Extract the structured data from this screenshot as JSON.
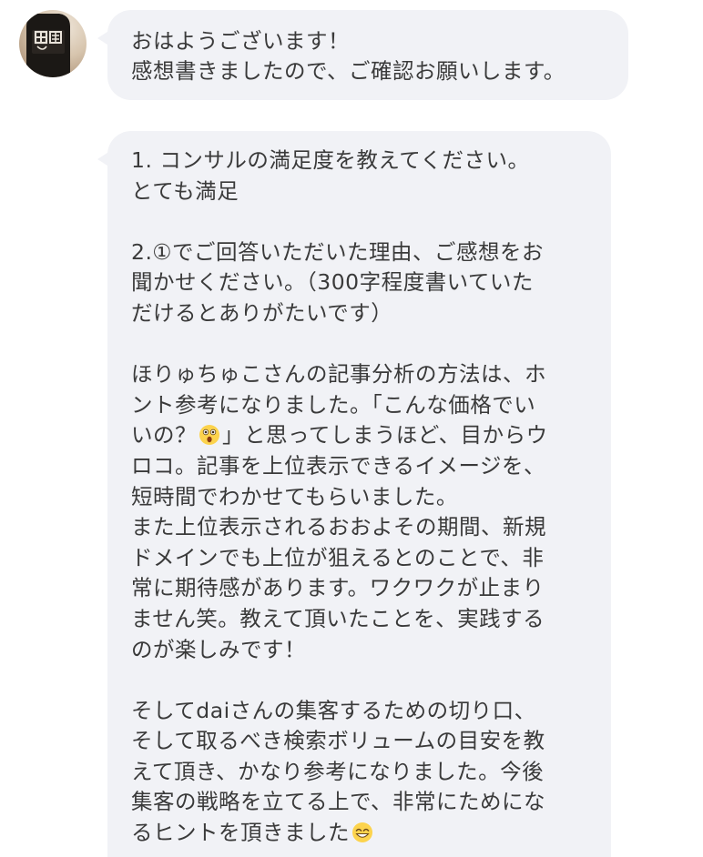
{
  "sender": {
    "avatar_icon": "sake-bottle-avatar-icon"
  },
  "messages": [
    {
      "lines": [
        "おはようございます！",
        "感想書きましたので、ご確認お願いします。"
      ]
    },
    {
      "q1": {
        "question": "1. コンサルの満足度を教えてください。",
        "answer": "とても満足"
      },
      "q2": {
        "question_lines": [
          "2.①でご回答いただいた理由、ご感想をお",
          "聞かせください。（300字程度書いていた",
          "だけるとありがたいです）"
        ]
      },
      "paragraph1": {
        "line1": "ほりゅちゅこさんの記事分析の方法は、ホ",
        "line2": "ント参考になりました。「こんな価格でい",
        "line3_before": "いの？",
        "line3_emoji": "astonished-face-emoji",
        "line3_after": "」と思ってしまうほど、目からウ",
        "line4": "ロコ。記事を上位表示できるイメージを、",
        "line5": "短時間でわかせてもらいました。",
        "line6": "また上位表示されるおおよその期間、新規",
        "line7": "ドメインでも上位が狙えるとのことで、非",
        "line8": "常に期待感があります。ワクワクが止まり",
        "line9": "ません笑。教えて頂いたことを、実践する",
        "line10": "のが楽しみです！"
      },
      "paragraph2": {
        "line1": "そしてdaiさんの集客するための切り口、",
        "line2": "そして取るべき検索ボリュームの目安を教",
        "line3": "えて頂き、かなり参考になりました。今後",
        "line4": "集客の戦略を立てる上で、非常にためにな",
        "line5_before": "るヒントを頂きました",
        "line5_emoji": "grinning-smiling-eyes-emoji"
      }
    }
  ],
  "colors": {
    "bubble": "#f1f2f6",
    "text": "#3a3a3a",
    "background": "#ffffff"
  }
}
